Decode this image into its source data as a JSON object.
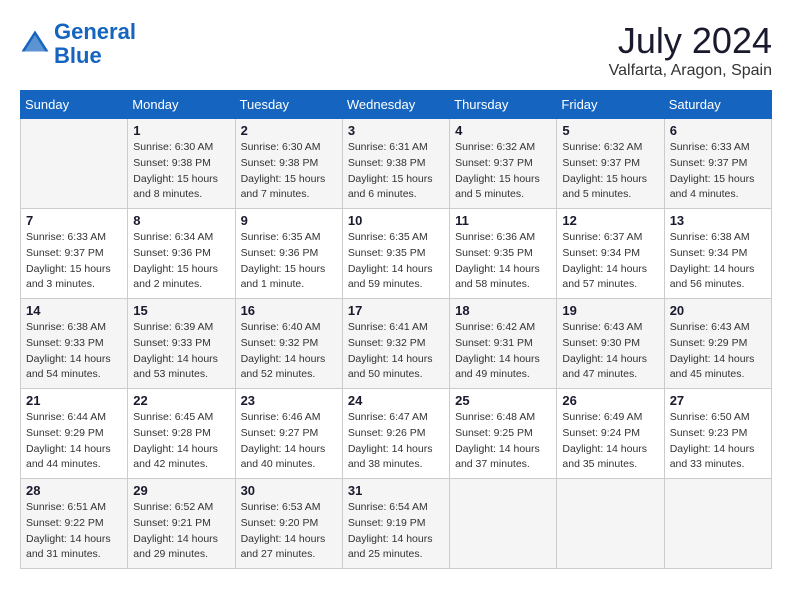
{
  "header": {
    "logo_line1": "General",
    "logo_line2": "Blue",
    "month_year": "July 2024",
    "location": "Valfarta, Aragon, Spain"
  },
  "weekdays": [
    "Sunday",
    "Monday",
    "Tuesday",
    "Wednesday",
    "Thursday",
    "Friday",
    "Saturday"
  ],
  "weeks": [
    [
      {
        "day": "",
        "info": ""
      },
      {
        "day": "1",
        "info": "Sunrise: 6:30 AM\nSunset: 9:38 PM\nDaylight: 15 hours\nand 8 minutes."
      },
      {
        "day": "2",
        "info": "Sunrise: 6:30 AM\nSunset: 9:38 PM\nDaylight: 15 hours\nand 7 minutes."
      },
      {
        "day": "3",
        "info": "Sunrise: 6:31 AM\nSunset: 9:38 PM\nDaylight: 15 hours\nand 6 minutes."
      },
      {
        "day": "4",
        "info": "Sunrise: 6:32 AM\nSunset: 9:37 PM\nDaylight: 15 hours\nand 5 minutes."
      },
      {
        "day": "5",
        "info": "Sunrise: 6:32 AM\nSunset: 9:37 PM\nDaylight: 15 hours\nand 5 minutes."
      },
      {
        "day": "6",
        "info": "Sunrise: 6:33 AM\nSunset: 9:37 PM\nDaylight: 15 hours\nand 4 minutes."
      }
    ],
    [
      {
        "day": "7",
        "info": "Sunrise: 6:33 AM\nSunset: 9:37 PM\nDaylight: 15 hours\nand 3 minutes."
      },
      {
        "day": "8",
        "info": "Sunrise: 6:34 AM\nSunset: 9:36 PM\nDaylight: 15 hours\nand 2 minutes."
      },
      {
        "day": "9",
        "info": "Sunrise: 6:35 AM\nSunset: 9:36 PM\nDaylight: 15 hours\nand 1 minute."
      },
      {
        "day": "10",
        "info": "Sunrise: 6:35 AM\nSunset: 9:35 PM\nDaylight: 14 hours\nand 59 minutes."
      },
      {
        "day": "11",
        "info": "Sunrise: 6:36 AM\nSunset: 9:35 PM\nDaylight: 14 hours\nand 58 minutes."
      },
      {
        "day": "12",
        "info": "Sunrise: 6:37 AM\nSunset: 9:34 PM\nDaylight: 14 hours\nand 57 minutes."
      },
      {
        "day": "13",
        "info": "Sunrise: 6:38 AM\nSunset: 9:34 PM\nDaylight: 14 hours\nand 56 minutes."
      }
    ],
    [
      {
        "day": "14",
        "info": "Sunrise: 6:38 AM\nSunset: 9:33 PM\nDaylight: 14 hours\nand 54 minutes."
      },
      {
        "day": "15",
        "info": "Sunrise: 6:39 AM\nSunset: 9:33 PM\nDaylight: 14 hours\nand 53 minutes."
      },
      {
        "day": "16",
        "info": "Sunrise: 6:40 AM\nSunset: 9:32 PM\nDaylight: 14 hours\nand 52 minutes."
      },
      {
        "day": "17",
        "info": "Sunrise: 6:41 AM\nSunset: 9:32 PM\nDaylight: 14 hours\nand 50 minutes."
      },
      {
        "day": "18",
        "info": "Sunrise: 6:42 AM\nSunset: 9:31 PM\nDaylight: 14 hours\nand 49 minutes."
      },
      {
        "day": "19",
        "info": "Sunrise: 6:43 AM\nSunset: 9:30 PM\nDaylight: 14 hours\nand 47 minutes."
      },
      {
        "day": "20",
        "info": "Sunrise: 6:43 AM\nSunset: 9:29 PM\nDaylight: 14 hours\nand 45 minutes."
      }
    ],
    [
      {
        "day": "21",
        "info": "Sunrise: 6:44 AM\nSunset: 9:29 PM\nDaylight: 14 hours\nand 44 minutes."
      },
      {
        "day": "22",
        "info": "Sunrise: 6:45 AM\nSunset: 9:28 PM\nDaylight: 14 hours\nand 42 minutes."
      },
      {
        "day": "23",
        "info": "Sunrise: 6:46 AM\nSunset: 9:27 PM\nDaylight: 14 hours\nand 40 minutes."
      },
      {
        "day": "24",
        "info": "Sunrise: 6:47 AM\nSunset: 9:26 PM\nDaylight: 14 hours\nand 38 minutes."
      },
      {
        "day": "25",
        "info": "Sunrise: 6:48 AM\nSunset: 9:25 PM\nDaylight: 14 hours\nand 37 minutes."
      },
      {
        "day": "26",
        "info": "Sunrise: 6:49 AM\nSunset: 9:24 PM\nDaylight: 14 hours\nand 35 minutes."
      },
      {
        "day": "27",
        "info": "Sunrise: 6:50 AM\nSunset: 9:23 PM\nDaylight: 14 hours\nand 33 minutes."
      }
    ],
    [
      {
        "day": "28",
        "info": "Sunrise: 6:51 AM\nSunset: 9:22 PM\nDaylight: 14 hours\nand 31 minutes."
      },
      {
        "day": "29",
        "info": "Sunrise: 6:52 AM\nSunset: 9:21 PM\nDaylight: 14 hours\nand 29 minutes."
      },
      {
        "day": "30",
        "info": "Sunrise: 6:53 AM\nSunset: 9:20 PM\nDaylight: 14 hours\nand 27 minutes."
      },
      {
        "day": "31",
        "info": "Sunrise: 6:54 AM\nSunset: 9:19 PM\nDaylight: 14 hours\nand 25 minutes."
      },
      {
        "day": "",
        "info": ""
      },
      {
        "day": "",
        "info": ""
      },
      {
        "day": "",
        "info": ""
      }
    ]
  ]
}
